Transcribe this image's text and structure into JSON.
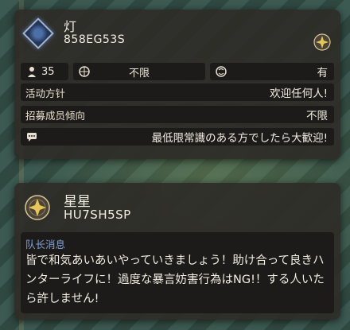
{
  "team": {
    "name": "灯",
    "code": "858EG53S",
    "member_count": "35",
    "rank_limit": "不限",
    "voice_chat": "有",
    "policy_label": "活动方针",
    "policy_value": "欢迎任何人!",
    "recruit_label": "招募成员倾向",
    "recruit_value": "不限",
    "comment": "最低限常識のある方でしたら大歓迎!"
  },
  "leader": {
    "name": "星星",
    "code": "HU7SH5SP",
    "message_label": "队长消息",
    "message": "皆で和気あいあいやっていきましょう！助け合って良きハンターライフに！過度な暴言妨害行為はNG!！する人いたら許しません!"
  },
  "icons": {
    "team_emblem": "blue-diamond-emblem",
    "hunter_badge": "hunter-badge-icon",
    "members": "person-icon",
    "rank": "globe-icon",
    "voice": "voice-chat-icon",
    "comment": "chat-bubble-icon"
  }
}
